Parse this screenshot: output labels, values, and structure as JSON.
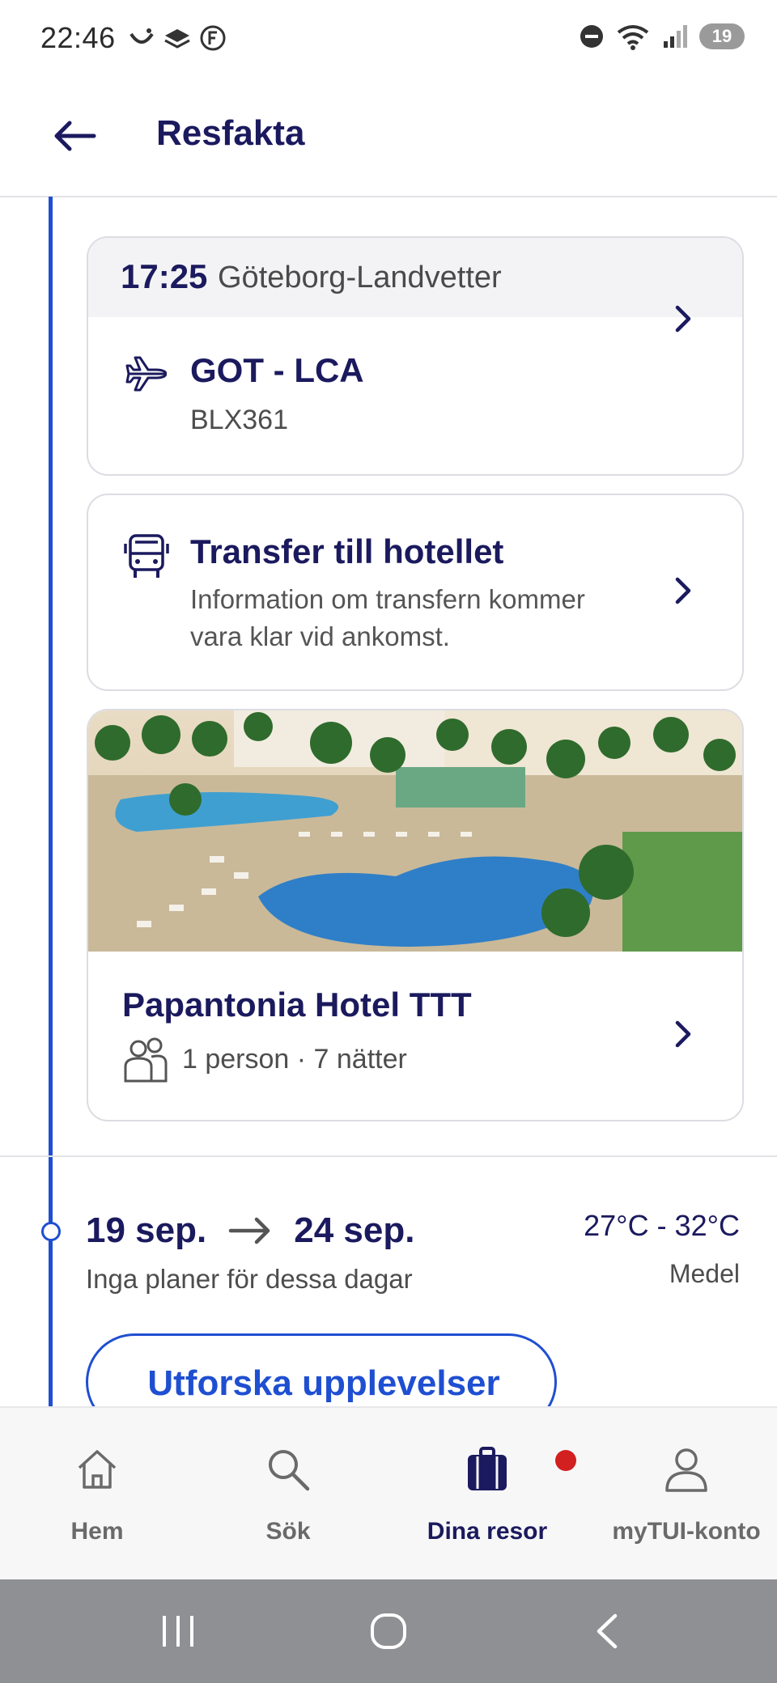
{
  "status_bar": {
    "time": "22:46",
    "battery": "19",
    "icons_left": [
      "tui-smile-icon",
      "layers-icon",
      "f-circle-icon"
    ],
    "icons_right": [
      "do-not-disturb-icon",
      "wifi-icon",
      "signal-icon",
      "battery-icon"
    ]
  },
  "header": {
    "title": "Resfakta",
    "back_icon": "arrow-left-icon"
  },
  "flight": {
    "time": "17:25",
    "airport": "Göteborg-Landvetter",
    "route": "GOT - LCA",
    "flight_number": "BLX361",
    "icon": "plane-icon"
  },
  "transfer": {
    "title": "Transfer till hotellet",
    "description": "Information om transfern kommer vara klar vid ankomst.",
    "icon": "bus-icon"
  },
  "hotel": {
    "name": "Papantonia Hotel TTT",
    "details": "1 person · 7 nätter",
    "icon": "people-icon"
  },
  "period": {
    "from": "19 sep.",
    "to": "24 sep.",
    "note": "Inga planer för dessa dagar",
    "temperature": "27°C - 32°C",
    "level": "Medel"
  },
  "explore_button": "Utforska upplevelser",
  "bottom_nav": {
    "items": [
      {
        "label": "Hem",
        "icon": "home-icon"
      },
      {
        "label": "Sök",
        "icon": "search-icon"
      },
      {
        "label": "Dina resor",
        "icon": "suitcase-icon",
        "active": true
      },
      {
        "label": "myTUI-konto",
        "icon": "user-icon"
      }
    ]
  },
  "colors": {
    "primary": "#1b1a5e",
    "accent": "#1f4fd1",
    "notification": "#d21f1f"
  }
}
